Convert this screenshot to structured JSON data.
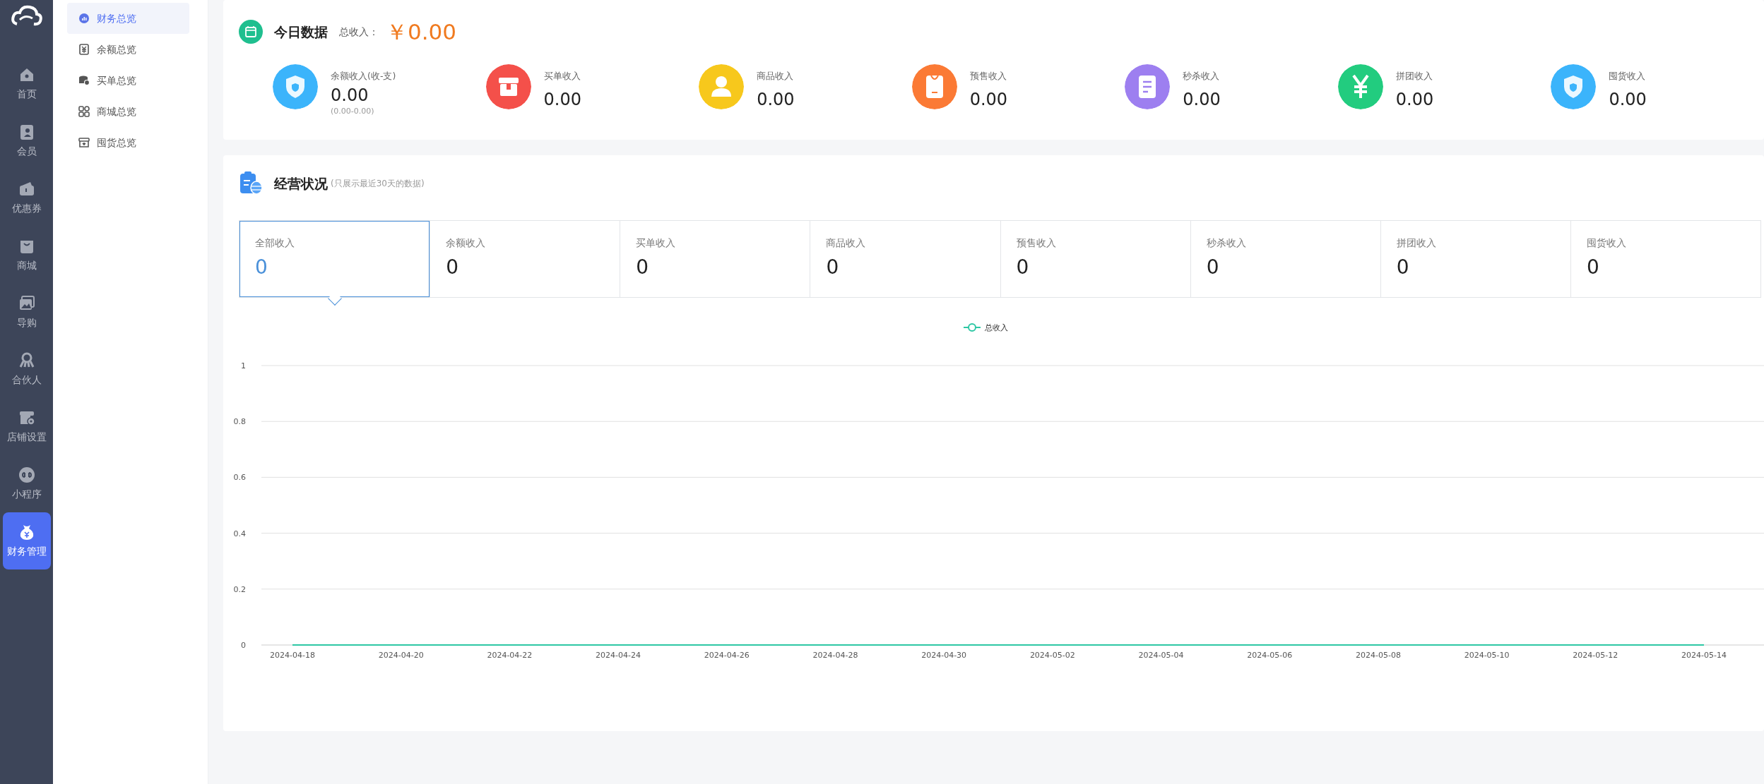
{
  "sidebar": {
    "items": [
      {
        "label": "首页",
        "selected": false
      },
      {
        "label": "会员",
        "selected": false
      },
      {
        "label": "优惠券",
        "selected": false
      },
      {
        "label": "商城",
        "selected": false
      },
      {
        "label": "导购",
        "selected": false
      },
      {
        "label": "合伙人",
        "selected": false
      },
      {
        "label": "店铺设置",
        "selected": false
      },
      {
        "label": "小程序",
        "selected": false
      },
      {
        "label": "财务管理",
        "selected": true
      }
    ]
  },
  "submenu": {
    "items": [
      {
        "label": "财务总览",
        "selected": true
      },
      {
        "label": "余额总览",
        "selected": false
      },
      {
        "label": "买单总览",
        "selected": false
      },
      {
        "label": "商城总览",
        "selected": false
      },
      {
        "label": "囤货总览",
        "selected": false
      }
    ]
  },
  "today": {
    "title": "今日数据",
    "total_label": "总收入：",
    "total_value": "￥0.00",
    "stats": [
      {
        "label": "余额收入(收-支)",
        "value": "0.00",
        "range": "(0.00-0.00)",
        "color": "#3bb4fb"
      },
      {
        "label": "买单收入",
        "value": "0.00",
        "color": "#f4504a"
      },
      {
        "label": "商品收入",
        "value": "0.00",
        "color": "#f7c81c"
      },
      {
        "label": "预售收入",
        "value": "0.00",
        "color": "#fb7a35"
      },
      {
        "label": "秒杀收入",
        "value": "0.00",
        "color": "#9d7ff0"
      },
      {
        "label": "拼团收入",
        "value": "0.00",
        "color": "#22cc7f"
      },
      {
        "label": "囤货收入",
        "value": "0.00",
        "color": "#3bb4fb"
      }
    ]
  },
  "business": {
    "title": "经营状况",
    "note": "(只展示最近30天的数据)",
    "tabs": [
      {
        "label": "全部收入",
        "value": "0",
        "selected": true
      },
      {
        "label": "余额收入",
        "value": "0",
        "selected": false
      },
      {
        "label": "买单收入",
        "value": "0",
        "selected": false
      },
      {
        "label": "商品收入",
        "value": "0",
        "selected": false
      },
      {
        "label": "预售收入",
        "value": "0",
        "selected": false
      },
      {
        "label": "秒杀收入",
        "value": "0",
        "selected": false
      },
      {
        "label": "拼团收入",
        "value": "0",
        "selected": false
      },
      {
        "label": "囤货收入",
        "value": "0",
        "selected": false
      }
    ],
    "chart_data": {
      "type": "line",
      "categories": [
        "2024-04-18",
        "2024-04-20",
        "2024-04-22",
        "2024-04-24",
        "2024-04-26",
        "2024-04-28",
        "2024-04-30",
        "2024-05-02",
        "2024-05-04",
        "2024-05-06",
        "2024-05-08",
        "2024-05-10",
        "2024-05-12",
        "2024-05-14"
      ],
      "series": [
        {
          "name": "总收入",
          "color": "#2ec7a4",
          "values": [
            0,
            0,
            0,
            0,
            0,
            0,
            0,
            0,
            0,
            0,
            0,
            0,
            0,
            0
          ]
        }
      ],
      "grid": true,
      "ylim": [
        0,
        1
      ],
      "yticks": [
        0,
        0.2,
        0.4,
        0.6,
        0.8,
        1
      ]
    }
  }
}
